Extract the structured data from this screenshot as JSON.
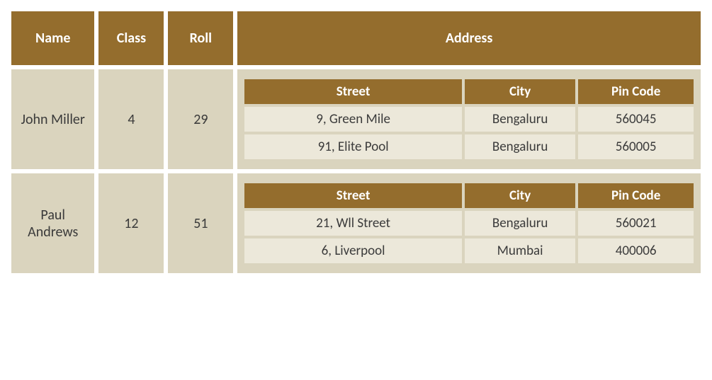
{
  "headers": {
    "name": "Name",
    "class": "Class",
    "roll": "Roll",
    "address": "Address"
  },
  "inner_headers": {
    "street": "Street",
    "city": "City",
    "pin": "Pin Code"
  },
  "rows": [
    {
      "name": "John Miller",
      "class": "4",
      "roll": "29",
      "addresses": [
        {
          "street": "9, Green Mile",
          "city": "Bengaluru",
          "pin": "560045"
        },
        {
          "street": "91, Elite Pool",
          "city": "Bengaluru",
          "pin": "560005"
        }
      ]
    },
    {
      "name": "Paul Andrews",
      "class": "12",
      "roll": "51",
      "addresses": [
        {
          "street": "21, Wll Street",
          "city": "Bengaluru",
          "pin": "560021"
        },
        {
          "street": "6, Liverpool",
          "city": "Mumbai",
          "pin": "400006"
        }
      ]
    }
  ]
}
